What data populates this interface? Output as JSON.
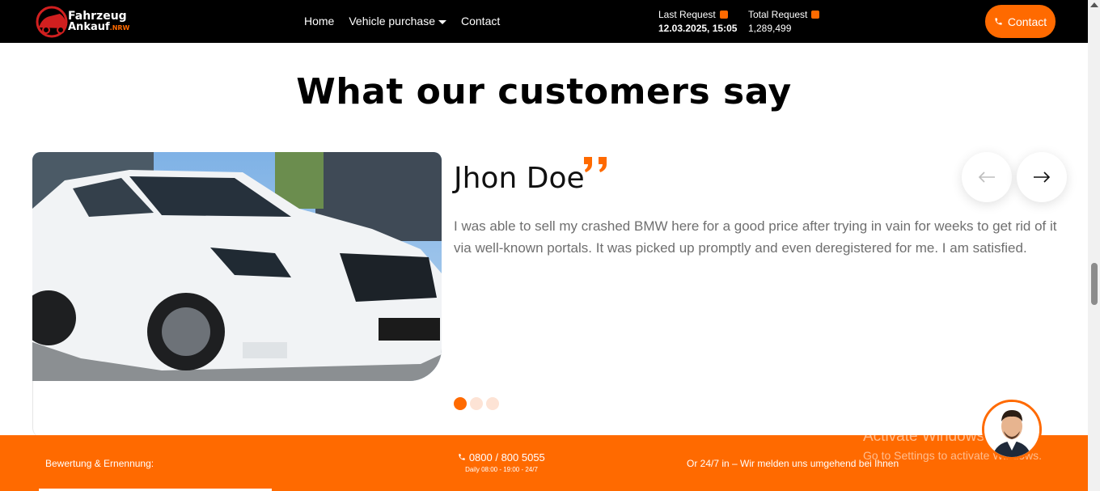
{
  "header": {
    "logo_line1": "Fahrzeug",
    "logo_line2": "Ankauf",
    "logo_suffix": ".NRW",
    "nav": [
      {
        "label": "Home"
      },
      {
        "label": "Vehicle purchase"
      },
      {
        "label": "Contact"
      }
    ],
    "last_request_label": "Last Request",
    "last_request_value": "12.03.2025, 15:05",
    "total_request_label": "Total Request",
    "total_request_value": "1,289,499",
    "contact_button": "Contact"
  },
  "section": {
    "heading": "What our customers say"
  },
  "testimonial": {
    "name": "Jhon Doe",
    "text": "I was able to sell my crashed BMW here for a good price after trying in vain for weeks to get rid of it via well-known portals. It was picked up promptly and even deregistered for me. I am satisfied.",
    "active_slide": 1,
    "total_slides": 3
  },
  "footer": {
    "left": "Bewertung & Ernennung:",
    "phone": "0800 / 800 5055",
    "hours": "Daily 08:00 - 19:00 - 24/7",
    "right": "Or 24/7 in – Wir melden uns umgehend bei Ihnen"
  },
  "watermark": {
    "title": "Activate Windows",
    "subtitle": "Go to Settings to activate Windows."
  },
  "colors": {
    "accent": "#ff6a00",
    "header_bg": "#000000",
    "text_muted": "#6f6f6f"
  },
  "icons": [
    "car-logo-icon",
    "clock-icon",
    "chart-icon",
    "phone-icon",
    "quote-icon",
    "arrow-left-icon",
    "arrow-right-icon"
  ]
}
